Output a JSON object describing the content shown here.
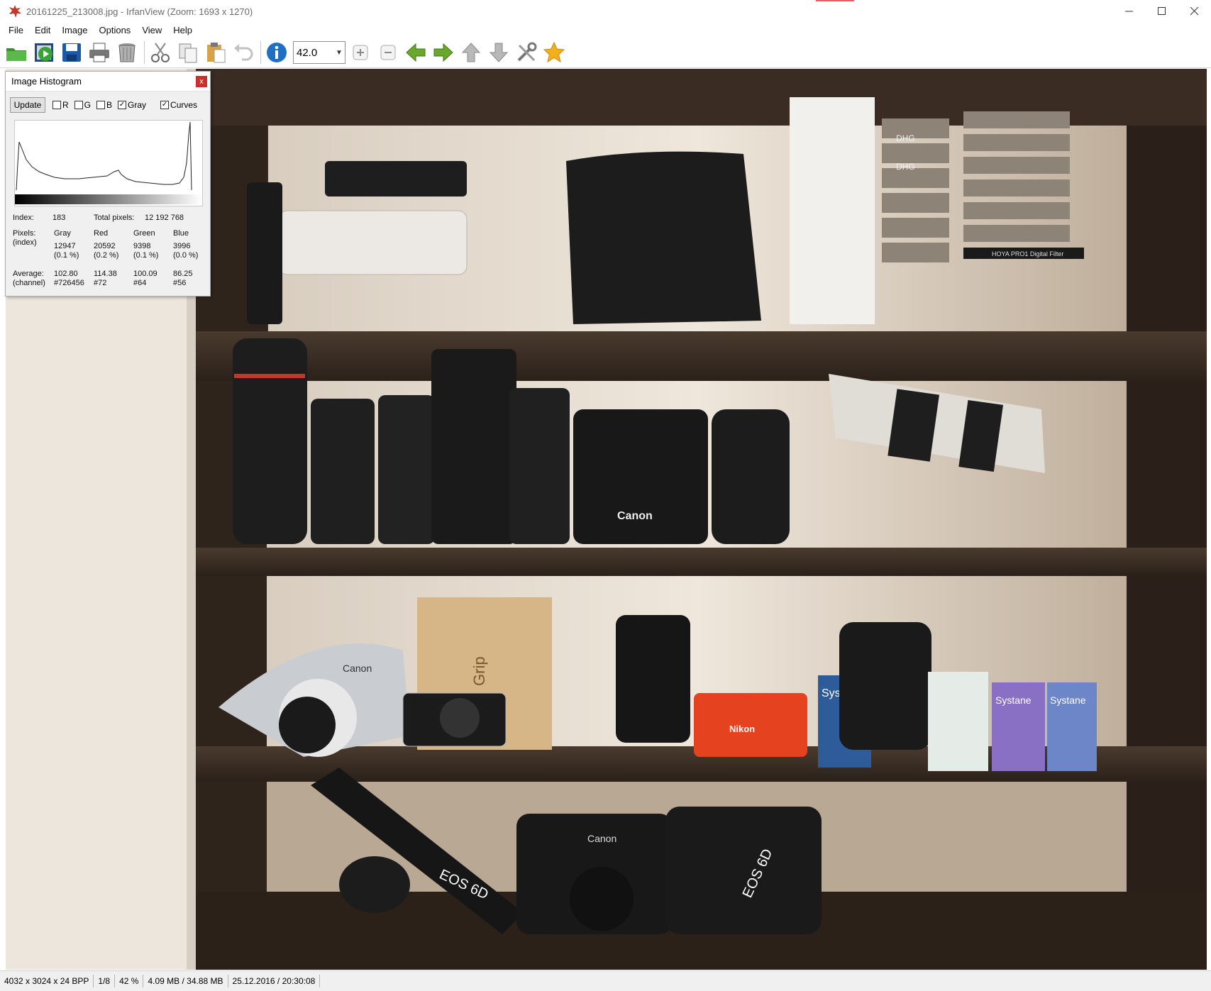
{
  "window": {
    "title": "20161225_213008.jpg - IrfanView (Zoom: 1693 x 1270)",
    "icons": {
      "app": "irfanview-cat-icon",
      "minimize": "minimize-icon",
      "maximize": "maximize-icon",
      "close": "close-icon"
    }
  },
  "menu": [
    "File",
    "Edit",
    "Image",
    "Options",
    "View",
    "Help"
  ],
  "toolbar": {
    "zoom_value": "42.0",
    "buttons": [
      "open-icon",
      "slideshow-icon",
      "save-icon",
      "print-icon",
      "delete-icon",
      "cut-icon",
      "copy-icon",
      "paste-icon",
      "undo-icon",
      "info-icon",
      "zoom-in-icon",
      "zoom-out-icon",
      "previous-icon",
      "next-icon",
      "first-icon",
      "last-icon",
      "settings-icon",
      "favorites-icon"
    ]
  },
  "histogram": {
    "title": "Image Histogram",
    "close": "x",
    "update_label": "Update",
    "checkboxes": [
      {
        "label": "R",
        "checked": false
      },
      {
        "label": "G",
        "checked": false
      },
      {
        "label": "B",
        "checked": false
      },
      {
        "label": "Gray",
        "checked": true
      },
      {
        "label": "Curves",
        "checked": true
      }
    ],
    "index_label": "Index:",
    "index_value": "183",
    "total_pixels_label": "Total pixels:",
    "total_pixels_value": "12 192 768",
    "pixels_label": "Pixels:",
    "pixels_sub": "(index)",
    "columns": [
      "Gray",
      "Red",
      "Green",
      "Blue"
    ],
    "pixel_counts": [
      "12947",
      "20592",
      "9398",
      "3996"
    ],
    "pixel_percent": [
      "(0.1 %)",
      "(0.2 %)",
      "(0.1 %)",
      "(0.0 %)"
    ],
    "average_label": "Average:",
    "average_sub": "(channel)",
    "averages": [
      "102.80",
      "114.38",
      "100.09",
      "86.25"
    ],
    "hex": [
      "#726456",
      "#72",
      "#64",
      "#56"
    ]
  },
  "photo_text": {
    "canon_1": "Canon",
    "canon_2": "Canon",
    "canon_3": "Canon",
    "nikon": "Nikon",
    "systane_1": "Systane",
    "systane_2": "Systane",
    "systane_3": "Systane",
    "eos_1": "EOS 6D",
    "eos_2": "EOS 6D",
    "dhg_1": "DHG",
    "dhg_2": "DHG",
    "hoya": "HOYA PRO1 Digital Filter",
    "grip": "Grip"
  },
  "status": {
    "dimensions": "4032 x 3024 x 24 BPP",
    "position": "1/8",
    "zoom": "42 %",
    "size": "4.09 MB / 34.88 MB",
    "datetime": "25.12.2016 / 20:30:08"
  }
}
